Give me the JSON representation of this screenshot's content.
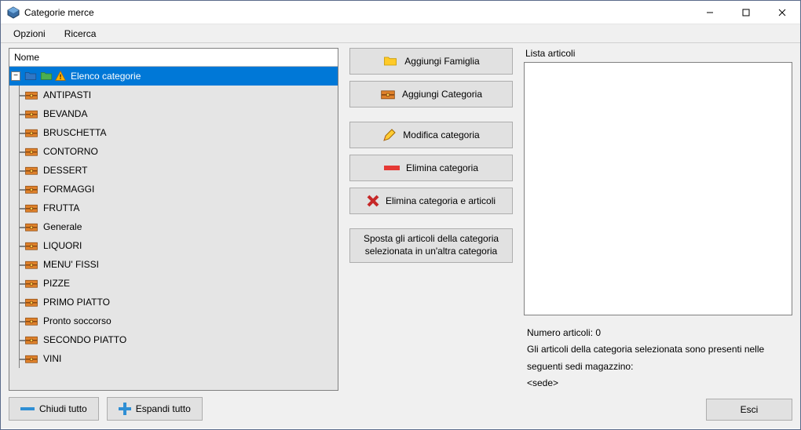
{
  "window": {
    "title": "Categorie merce"
  },
  "menu": {
    "opzioni": "Opzioni",
    "ricerca": "Ricerca"
  },
  "tree": {
    "header": "Nome",
    "root": "Elenco categorie",
    "items": [
      "ANTIPASTI",
      "BEVANDA",
      "BRUSCHETTA",
      "CONTORNO",
      "DESSERT",
      "FORMAGGI",
      "FRUTTA",
      "Generale",
      "LIQUORI",
      "MENU' FISSI",
      "PIZZE",
      "PRIMO PIATTO",
      "Pronto soccorso",
      "SECONDO PIATTO",
      "VINI"
    ]
  },
  "left_footer": {
    "chiudi_tutto": "Chiudi tutto",
    "espandi_tutto": "Espandi tutto"
  },
  "mid": {
    "aggiungi_famiglia": "Aggiungi Famiglia",
    "aggiungi_categoria": "Aggiungi Categoria",
    "modifica_categoria": "Modifica categoria",
    "elimina_categoria": "Elimina categoria",
    "elimina_categoria_articoli": "Elimina categoria e articoli",
    "sposta": "Sposta gli articoli della categoria selezionata in un'altra categoria"
  },
  "right": {
    "lista_articoli": "Lista articoli",
    "numero_articoli_label": "Numero articoli: ",
    "numero_articoli_value": "0",
    "presenti_text": "Gli articoli della categoria selezionata sono presenti nelle seguenti sedi magazzino:",
    "sede": "<sede>",
    "esci": "Esci"
  }
}
